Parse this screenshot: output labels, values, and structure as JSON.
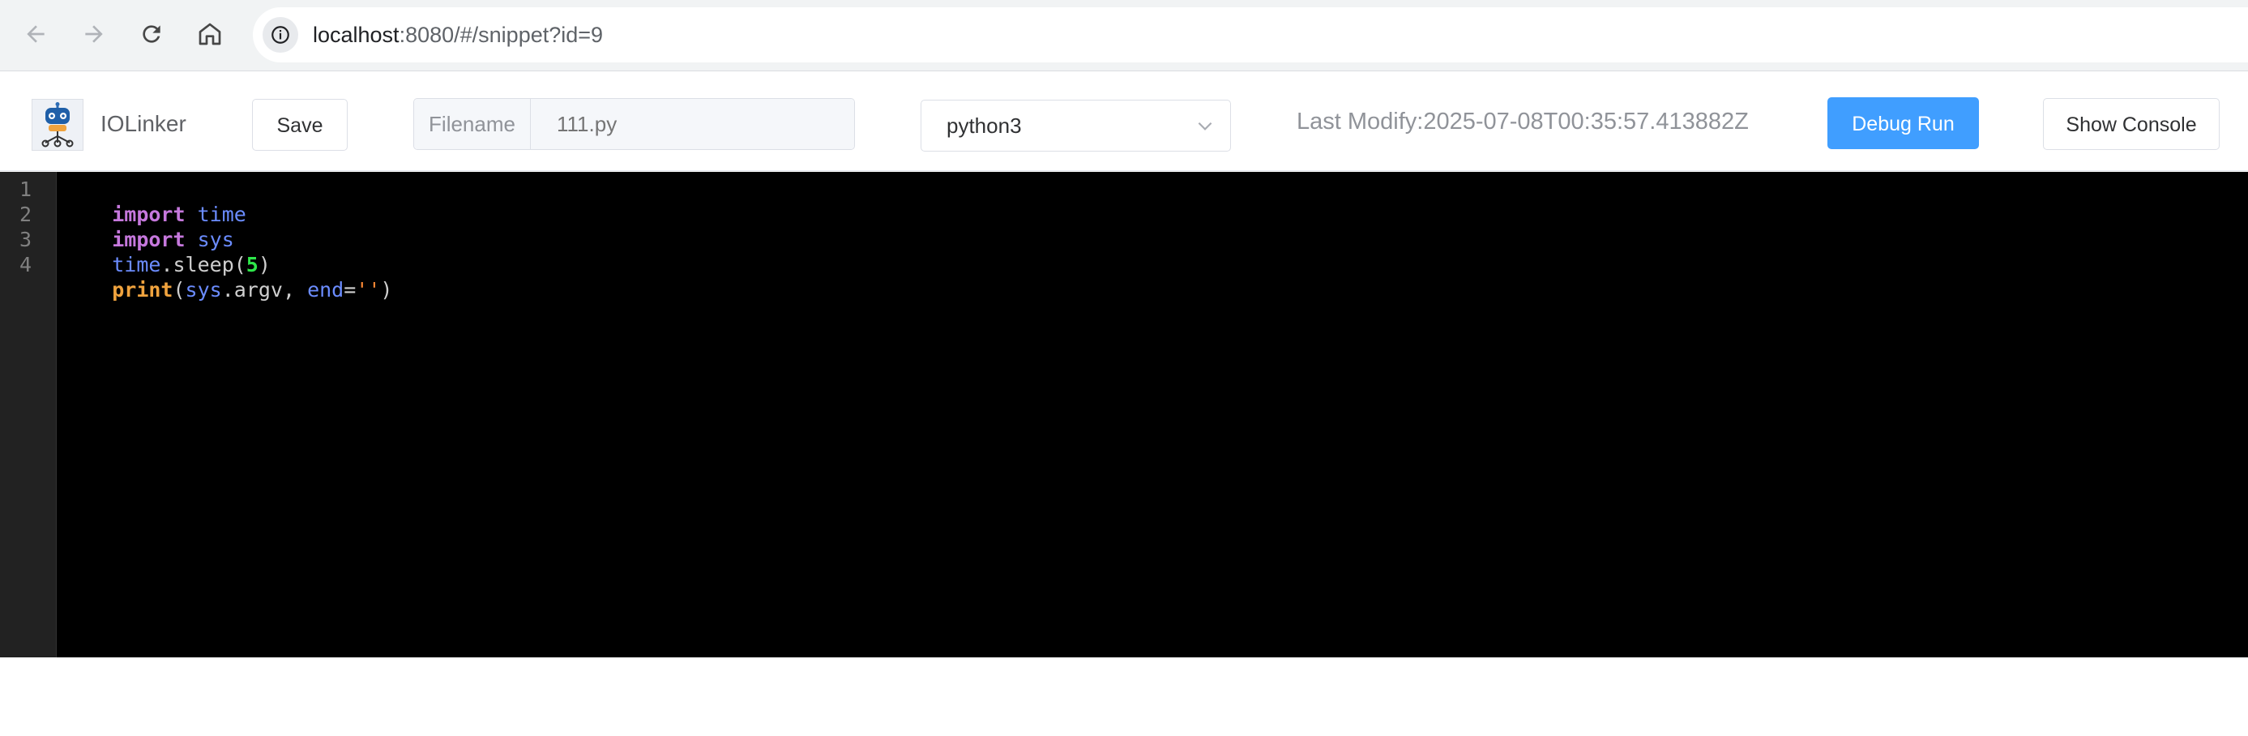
{
  "browser": {
    "url_host": "localhost",
    "url_path": ":8080/#/snippet?id=9",
    "icons": [
      "back-arrow-icon",
      "forward-arrow-icon",
      "reload-icon",
      "home-icon",
      "info-icon"
    ]
  },
  "header": {
    "app_name": "IOLinker",
    "save_label": "Save",
    "filename_label": "Filename",
    "filename_placeholder": "111.py",
    "language": "python3",
    "last_modify": "Last Modify:2025-07-08T00:35:57.413882Z",
    "debug_label": "Debug Run",
    "console_label": "Show Console"
  },
  "editor": {
    "line_numbers": [
      "1",
      "2",
      "3",
      "4"
    ],
    "lines": [
      [
        {
          "t": "import",
          "c": "kw"
        },
        {
          "t": " ",
          "c": "plain"
        },
        {
          "t": "time",
          "c": "mod"
        }
      ],
      [
        {
          "t": "import",
          "c": "kw"
        },
        {
          "t": " ",
          "c": "plain"
        },
        {
          "t": "sys",
          "c": "mod"
        }
      ],
      [
        {
          "t": "time",
          "c": "mod"
        },
        {
          "t": ".sleep(",
          "c": "plain"
        },
        {
          "t": "5",
          "c": "num"
        },
        {
          "t": ")",
          "c": "plain"
        }
      ],
      [
        {
          "t": "print",
          "c": "fn"
        },
        {
          "t": "(",
          "c": "plain"
        },
        {
          "t": "sys",
          "c": "mod"
        },
        {
          "t": ".argv, ",
          "c": "plain"
        },
        {
          "t": "end",
          "c": "mod"
        },
        {
          "t": "=",
          "c": "plain"
        },
        {
          "t": "''",
          "c": "str"
        },
        {
          "t": ")",
          "c": "plain"
        }
      ]
    ]
  },
  "colors": {
    "primary": "#409eff",
    "editor_bg": "#000000",
    "gutter_bg": "#222222"
  }
}
